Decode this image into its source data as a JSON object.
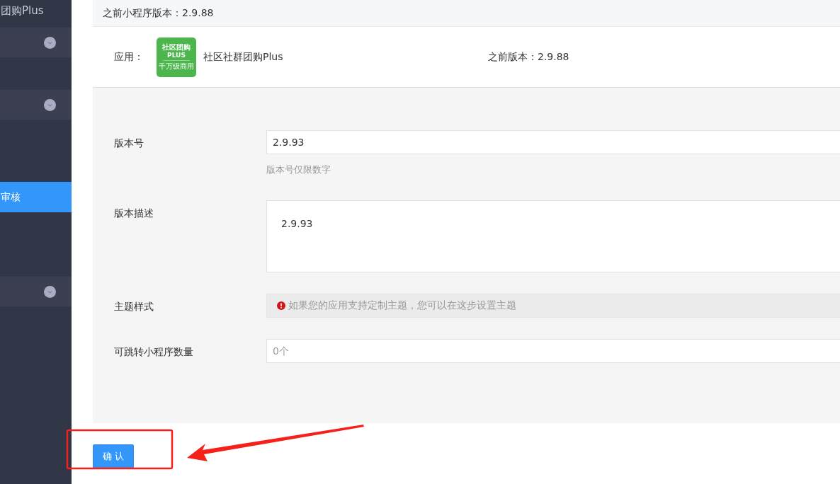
{
  "sidebar": {
    "brand": "团购Plus",
    "rows": [
      {
        "kind": "group"
      },
      {
        "kind": "spacer"
      },
      {
        "kind": "group"
      },
      {
        "kind": "spacer-tall"
      },
      {
        "kind": "item",
        "label": "审核",
        "selected": true
      },
      {
        "kind": "spacer-mid"
      },
      {
        "kind": "group"
      }
    ]
  },
  "header": {
    "text": "之前小程序版本：2.9.88"
  },
  "app": {
    "label": "应用：",
    "logo": {
      "line1": "社区团购",
      "line2": "PLUS",
      "line3": "千万级商用"
    },
    "name": "社区社群团购Plus",
    "previous": "之前版本：2.9.88"
  },
  "form": [
    {
      "kind": "input",
      "label": "版本号",
      "value": "2.9.93",
      "help": "版本号仅限数字"
    },
    {
      "kind": "textarea",
      "label": "版本描述",
      "value": "2.9.93"
    },
    {
      "kind": "alert",
      "label": "主题样式",
      "text": "如果您的应用支持定制主题，您可以在这步设置主题"
    },
    {
      "kind": "input",
      "label": "可跳转小程序数量",
      "placeholder": "0个"
    }
  ],
  "submit": {
    "label": "确 认"
  }
}
